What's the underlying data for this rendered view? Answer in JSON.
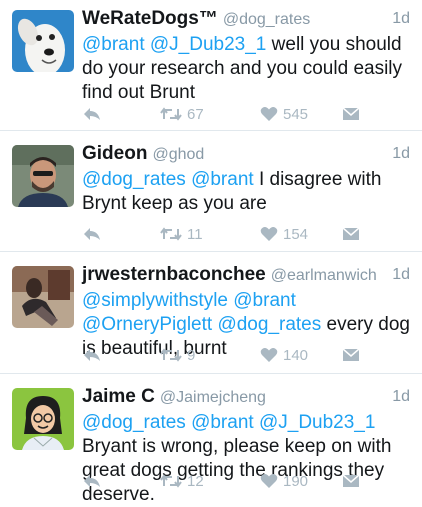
{
  "tweets": [
    {
      "name": "WeRateDogs™",
      "handle": "@dog_rates",
      "time": "1d",
      "text": [
        {
          "t": "@brant",
          "m": true
        },
        {
          "t": " ",
          "m": false
        },
        {
          "t": "@J_Dub23_1",
          "m": true
        },
        {
          "t": " well you should do your research and you could easily find out Brunt",
          "m": false
        }
      ],
      "retweets": "67",
      "likes": "545",
      "avatar": "dog-photo"
    },
    {
      "name": "Gideon",
      "handle": "@ghod",
      "time": "1d",
      "text": [
        {
          "t": "@dog_rates",
          "m": true
        },
        {
          "t": " ",
          "m": false
        },
        {
          "t": "@brant",
          "m": true
        },
        {
          "t": " I disagree with Brynt keep as you are",
          "m": false
        }
      ],
      "retweets": "11",
      "likes": "154",
      "avatar": "man-photo"
    },
    {
      "name": "jrwesternbaconchee",
      "handle": "@earlmanwich",
      "time": "1d",
      "text": [
        {
          "t": "@simplywithstyle",
          "m": true
        },
        {
          "t": " ",
          "m": false
        },
        {
          "t": "@brant",
          "m": true
        },
        {
          "t": " ",
          "m": false
        },
        {
          "t": "@OrneryPiglett",
          "m": true
        },
        {
          "t": " ",
          "m": false
        },
        {
          "t": "@dog_rates",
          "m": true
        },
        {
          "t": " every dog is beautiful, burnt",
          "m": false
        }
      ],
      "retweets": "9",
      "likes": "140",
      "avatar": "person-sitting-photo"
    },
    {
      "name": "Jaime C",
      "handle": "@Jaimejcheng",
      "time": "1d",
      "text": [
        {
          "t": "@dog_rates",
          "m": true
        },
        {
          "t": " ",
          "m": false
        },
        {
          "t": "@brant",
          "m": true
        },
        {
          "t": " ",
          "m": false
        },
        {
          "t": "@J_Dub23_1",
          "m": true
        },
        {
          "t": " Bryant is wrong, please keep on with great dogs getting the rankings they deserve.",
          "m": false
        }
      ],
      "retweets": "12",
      "likes": "190",
      "avatar": "cartoon-woman-illustration"
    }
  ],
  "colors": {
    "mention": "#1da1f2",
    "meta": "#8899a6",
    "action": "#aab8c2",
    "divider": "#e1e8ed"
  }
}
